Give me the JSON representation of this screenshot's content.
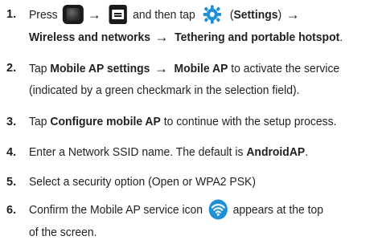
{
  "steps": [
    {
      "number": "1.",
      "press": "Press",
      "and_then_tap": "and then tap",
      "settings_paren_open": "(",
      "settings_label": "Settings",
      "settings_paren_close": ")",
      "path_wireless": "Wireless and networks",
      "path_tethering": "Tethering and portable hotspot",
      "period": "."
    },
    {
      "number": "2.",
      "tap": "Tap",
      "mobile_ap_settings": "Mobile AP settings",
      "mobile_ap": "Mobile AP",
      "text_after": "to activate the service",
      "line2": "(indicated by a green checkmark in the selection field)."
    },
    {
      "number": "3.",
      "tap": "Tap",
      "configure": "Configure mobile AP",
      "text_after": "to continue with the setup process."
    },
    {
      "number": "4.",
      "text_before": "Enter a Network SSID name. The default is",
      "default_name": "AndroidAP",
      "period": "."
    },
    {
      "number": "5.",
      "text": "Select a security option (Open or WPA2 PSK)"
    },
    {
      "number": "6.",
      "text_before": "Confirm the Mobile AP service icon",
      "text_after": "appears at the top",
      "line2": "of the screen."
    }
  ],
  "icons": {
    "home": "home-key-icon",
    "menu": "menu-key-icon",
    "settings": "settings-gear-icon",
    "wifi": "mobile-ap-wifi-icon",
    "arrow": "→"
  },
  "colors": {
    "text": "#231f20",
    "key_bg": "#1a1a1a",
    "settings_blue": "#1f8fd6",
    "wifi_blue": "#1e90d8"
  }
}
